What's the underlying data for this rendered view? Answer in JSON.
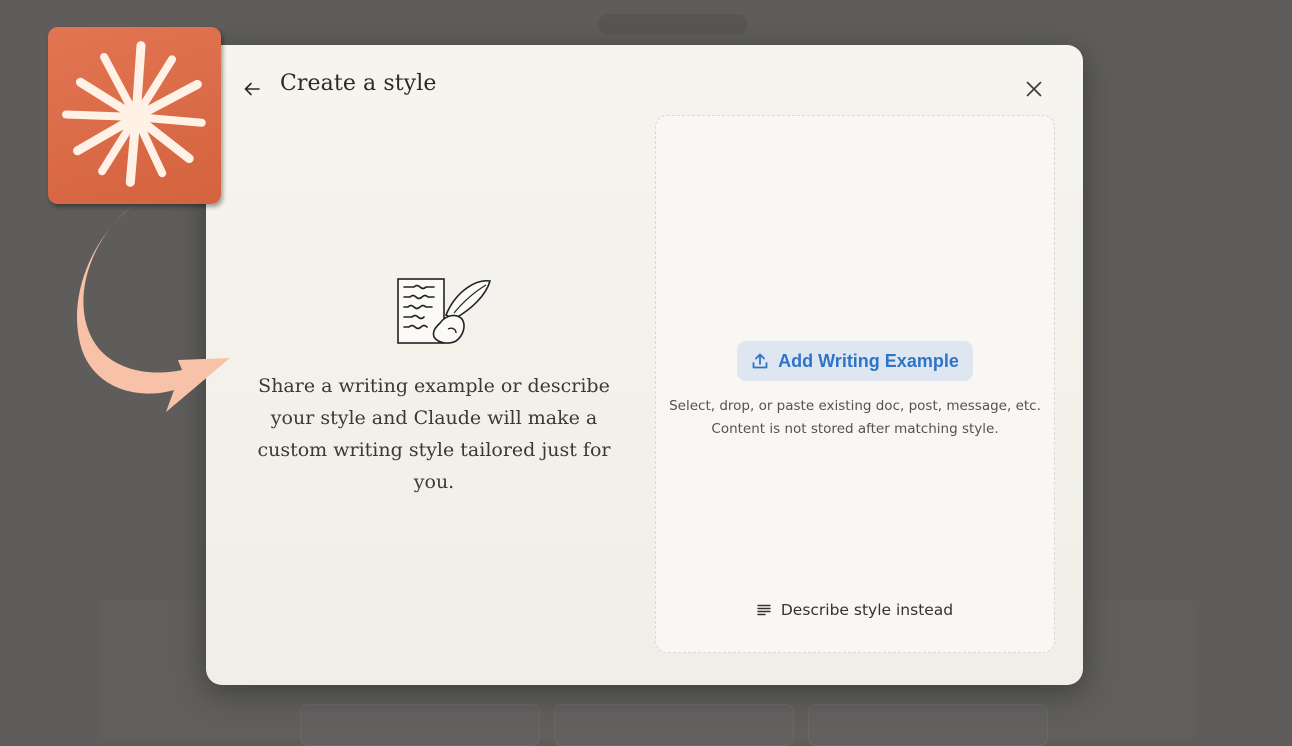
{
  "dialog": {
    "title": "Create a style",
    "intro_text": "Share a writing example or describe your style and Claude will make a custom writing style tailored just for you.",
    "add_button_label": "Add Writing Example",
    "helper_line_1": "Select, drop, or paste existing doc, post, message, etc.",
    "helper_line_2": "Content is not stored after matching style.",
    "describe_button_label": "Describe style instead"
  },
  "icons": {
    "back": "arrow-left-icon",
    "close": "close-x-icon",
    "upload": "upload-icon",
    "describe": "text-lines-icon",
    "illustration": "writing-hand-quill-illustration",
    "logo": "claude-sunburst-logo"
  },
  "colors": {
    "backdrop": "#5e5d5b",
    "modal_bg": "#f4f2ec",
    "accent_blue": "#2f74c6",
    "button_bg": "#dde6f1",
    "logo_orange": "#d96a45",
    "arrow_peach": "#f7c2a8"
  }
}
